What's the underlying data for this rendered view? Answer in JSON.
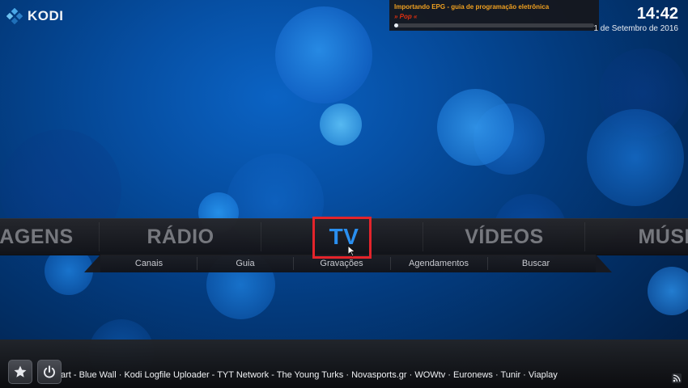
{
  "app": {
    "logo_text": "KODI"
  },
  "clock": {
    "time": "14:42",
    "date": "1 de Setembro de 2016"
  },
  "notification": {
    "title": "Importando EPG - guia de programação eletrônica",
    "subtitle": "» Pop «",
    "progress": 0.02
  },
  "menu": {
    "items": [
      {
        "label": "AGENS"
      },
      {
        "label": "RÁDIO"
      },
      {
        "label": "TV"
      },
      {
        "label": "VÍDEOS"
      },
      {
        "label": "MÚSIC"
      }
    ],
    "active_index": 2
  },
  "submenu": {
    "items": [
      {
        "label": "Canais"
      },
      {
        "label": "Guia"
      },
      {
        "label": "Gravações"
      },
      {
        "label": "Agendamentos"
      },
      {
        "label": "Buscar"
      }
    ]
  },
  "ticker": {
    "text": "art - Blue Wall · Kodi Logfile Uploader - TYT Network - The Young Turks · Novasports.gr · WOWtv · Euronews · Tunir · Viaplay"
  },
  "colors": {
    "accent": "#2a8ff0",
    "highlight": "#e3242b",
    "notification_title": "#f0a020",
    "notification_subtitle": "#e03010"
  },
  "icons": {
    "logo": "kodi-logo-icon",
    "favourites": "star-icon",
    "power": "power-icon",
    "rss": "rss-icon",
    "cursor": "mouse-pointer-icon"
  }
}
